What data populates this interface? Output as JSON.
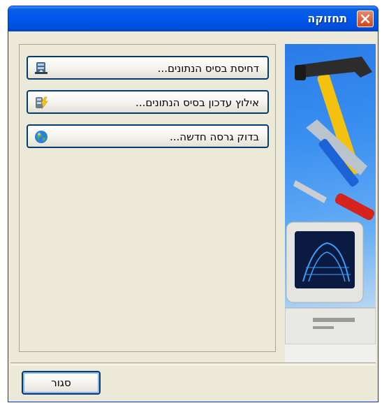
{
  "window": {
    "title": "תחזוקה",
    "close_icon": "close-x-icon"
  },
  "actions": [
    {
      "label": "דחיסת בסיס הנתונים...",
      "icon": "database-compress-icon"
    },
    {
      "label": "אילוץ עדכון בסיס הנתונים...",
      "icon": "database-update-lightning-icon"
    },
    {
      "label": "בדוק גרסה חדשה...",
      "icon": "globe-icon"
    }
  ],
  "footer": {
    "close_label": "סגור"
  },
  "colors": {
    "titlebar": "#0058ee",
    "dialog_bg": "#ece9d8",
    "button_border": "#003c74"
  }
}
